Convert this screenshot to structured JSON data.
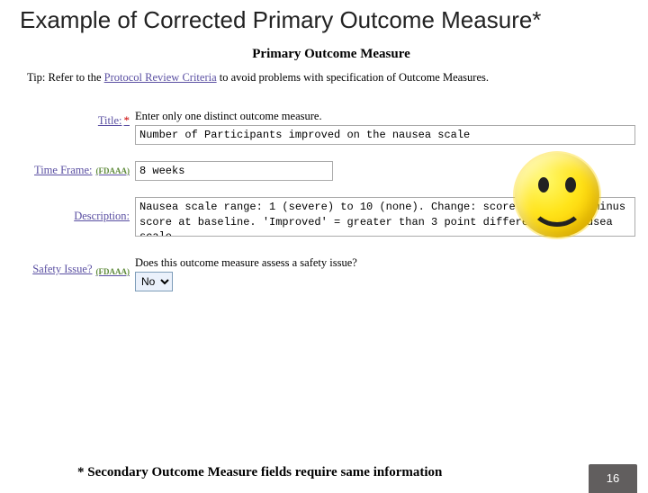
{
  "slide": {
    "title": "Example of Corrected Primary Outcome Measure*",
    "footnote": "* Secondary Outcome Measure fields require same information",
    "page_number": "16"
  },
  "form": {
    "section_header": "Primary Outcome Measure",
    "tip_prefix": "Tip: Refer to the ",
    "tip_link": "Protocol Review Criteria",
    "tip_suffix": " to avoid problems with specification of Outcome Measures.",
    "fdaa_tag": "(FDAAA)",
    "title": {
      "label": "Title:",
      "required_mark": "*",
      "helper": "Enter only one distinct outcome measure.",
      "value": "Number of Participants improved on the nausea scale"
    },
    "time_frame": {
      "label": "Time Frame:",
      "value": "8 weeks"
    },
    "description": {
      "label": "Description:",
      "value": "Nausea scale range: 1 (severe) to 10 (none). Change: score at 8 weeks minus score at baseline. 'Improved' = greater than 3 point difference in nausea scale."
    },
    "safety": {
      "label": "Safety Issue?",
      "question": "Does this outcome measure assess a safety issue?",
      "value": "No"
    }
  }
}
